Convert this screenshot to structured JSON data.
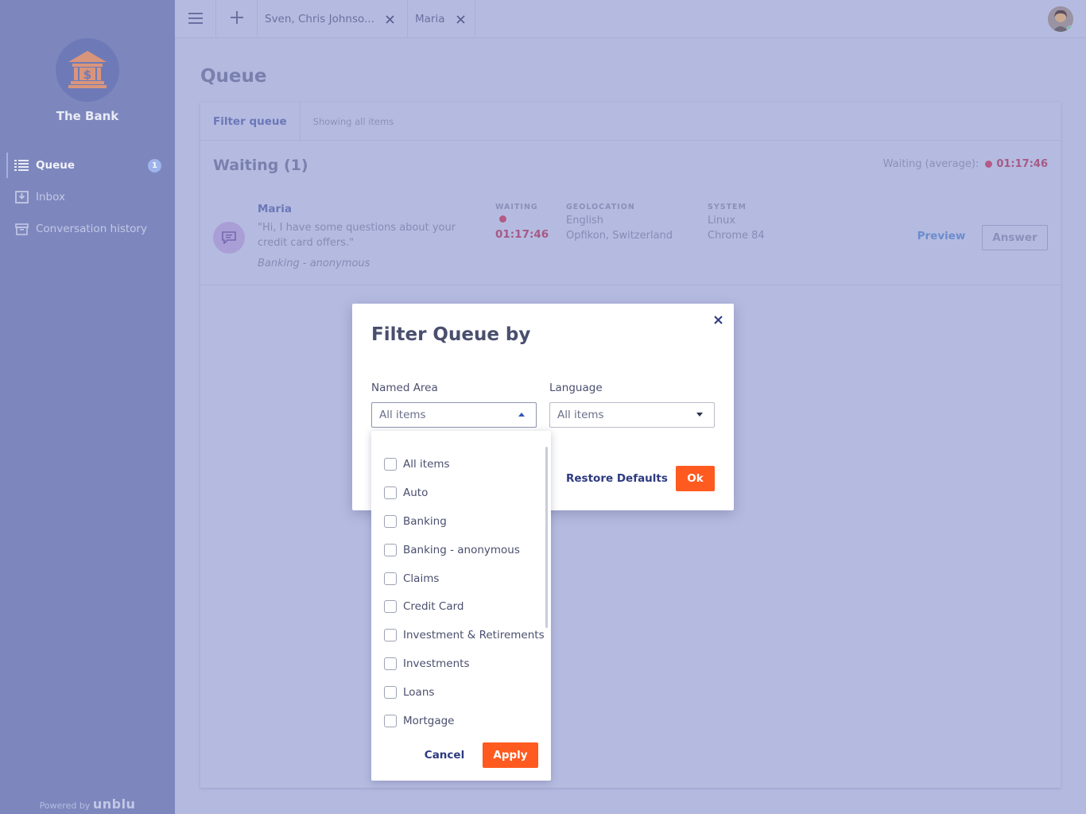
{
  "sidebar": {
    "brand_name": "The Bank",
    "logo_icon": "bank-icon",
    "items": [
      {
        "label": "Queue",
        "icon": "list-icon",
        "badge": "1",
        "active": true
      },
      {
        "label": "Inbox",
        "icon": "inbox-icon"
      },
      {
        "label": "Conversation history",
        "icon": "archive-icon"
      }
    ],
    "powered_by": "Powered by",
    "powered_brand": "unblu"
  },
  "topbar": {
    "menu_icon": "hamburger-menu-icon",
    "add_icon": "plus-icon",
    "tabs": [
      {
        "label": "Sven, Chris Johnso...",
        "close_icon": "close-icon"
      },
      {
        "label": "Maria",
        "close_icon": "close-icon"
      }
    ],
    "avatar_status": "online"
  },
  "page": {
    "title": "Queue",
    "filter_button": "Filter queue",
    "filter_status": "Showing all items",
    "waiting_heading": "Waiting (1)",
    "avg_label": "Waiting (average):",
    "avg_time": "01:17:46"
  },
  "conversation": {
    "name": "Maria",
    "message": "\"Hi, I have some questions about your credit card offers.\"",
    "named_area": "Banking - anonymous",
    "waiting_label": "WAITING",
    "waiting_time": "01:17:46",
    "geo_label": "GEOLOCATION",
    "geo_language": "English",
    "geo_location": "Opfikon, Switzerland",
    "system_label": "SYSTEM",
    "system_os": "Linux",
    "system_browser": "Chrome 84",
    "preview_label": "Preview",
    "answer_label": "Answer"
  },
  "modal": {
    "title": "Filter Queue by",
    "named_area_label": "Named Area",
    "named_area_value": "All items",
    "language_label": "Language",
    "language_value": "All items",
    "restore_label": "Restore Defaults",
    "ok_label": "Ok"
  },
  "dropdown": {
    "options": [
      {
        "label": "All items",
        "checked": false
      },
      {
        "label": "Auto",
        "checked": false
      },
      {
        "label": "Banking",
        "checked": false
      },
      {
        "label": "Banking - anonymous",
        "checked": false
      },
      {
        "label": "Claims",
        "checked": false
      },
      {
        "label": "Credit Card",
        "checked": false
      },
      {
        "label": "Investment & Retirements",
        "checked": false
      },
      {
        "label": "Investments",
        "checked": false
      },
      {
        "label": "Loans",
        "checked": false
      },
      {
        "label": "Mortgage",
        "checked": false
      }
    ],
    "cancel_label": "Cancel",
    "apply_label": "Apply"
  },
  "colors": {
    "accent": "#ff5a1f",
    "primary_dark": "#2d3a80",
    "overlay_sidebar": "#7d87bd",
    "overlay_main": "#b3b9df",
    "waiting_alert": "#a55a86"
  }
}
